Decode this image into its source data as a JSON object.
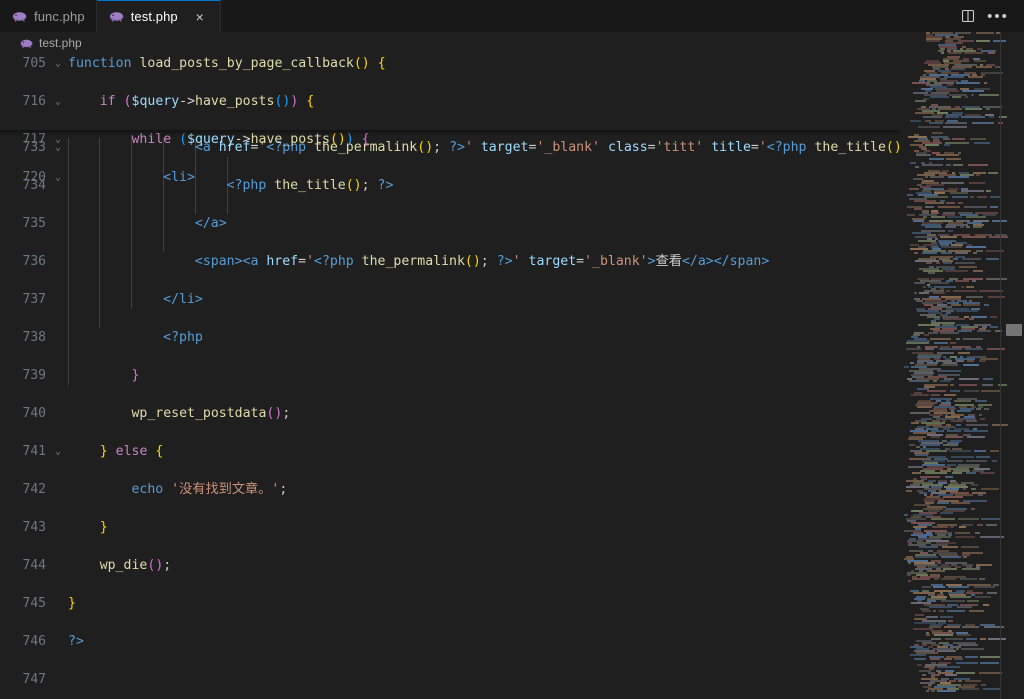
{
  "window": {
    "background": "#1f1f1f",
    "accent": "#0078d4"
  },
  "tabs": [
    {
      "label": "func.php",
      "icon": "php-elephant-icon",
      "active": false,
      "closable": false
    },
    {
      "label": "test.php",
      "icon": "php-elephant-icon",
      "active": true,
      "closable": true,
      "close_glyph": "×"
    }
  ],
  "tab_actions": {
    "split_editor_label": "Split Editor Right",
    "more_actions_label": "•••",
    "more_actions_name": "more-actions-icon"
  },
  "breadcrumb": {
    "icon": "php-elephant-icon",
    "label": "test.php"
  },
  "editor": {
    "language": "php",
    "sticky_lines": [
      {
        "num": "705",
        "fold": "⌄",
        "indent": 1,
        "tokens": [
          {
            "t": "function ",
            "c": "kb"
          },
          {
            "t": "load_posts_by_page_callback",
            "c": "fn"
          },
          {
            "t": "(",
            "c": "par"
          },
          {
            "t": ")",
            "c": "par"
          },
          {
            "t": " ",
            "c": "pun"
          },
          {
            "t": "{",
            "c": "brk"
          }
        ]
      },
      {
        "num": "716",
        "fold": "⌄",
        "indent": 2,
        "tokens": [
          {
            "t": "if ",
            "c": "k"
          },
          {
            "t": "(",
            "c": "pap"
          },
          {
            "t": "$query",
            "c": "var"
          },
          {
            "t": "->",
            "c": "op"
          },
          {
            "t": "have_posts",
            "c": "fn"
          },
          {
            "t": "(",
            "c": "pab"
          },
          {
            "t": ")",
            "c": "pab"
          },
          {
            "t": ")",
            "c": "pap"
          },
          {
            "t": " ",
            "c": "pun"
          },
          {
            "t": "{",
            "c": "par"
          }
        ]
      },
      {
        "num": "717",
        "fold": "⌄",
        "indent": 3,
        "tokens": [
          {
            "t": "while ",
            "c": "k"
          },
          {
            "t": "(",
            "c": "pab"
          },
          {
            "t": "$query",
            "c": "var"
          },
          {
            "t": "->",
            "c": "op"
          },
          {
            "t": "have_posts",
            "c": "fn"
          },
          {
            "t": "(",
            "c": "par"
          },
          {
            "t": ")",
            "c": "par"
          },
          {
            "t": ")",
            "c": "pab"
          },
          {
            "t": " ",
            "c": "pun"
          },
          {
            "t": "{",
            "c": "pap"
          }
        ]
      },
      {
        "num": "720",
        "fold": "⌄",
        "indent": 4,
        "tokens": [
          {
            "t": "<li>",
            "c": "tag"
          }
        ]
      }
    ],
    "lines": [
      {
        "num": "733",
        "fold": "⌄",
        "indent": 5,
        "clipped": true,
        "tokens": [
          {
            "t": "<a ",
            "c": "tag"
          },
          {
            "t": "href",
            "c": "atr"
          },
          {
            "t": "=",
            "c": "pun"
          },
          {
            "t": "'",
            "c": "str"
          },
          {
            "t": "<?php",
            "c": "php"
          },
          {
            "t": " ",
            "c": "pun"
          },
          {
            "t": "the_permalink",
            "c": "fn"
          },
          {
            "t": "(",
            "c": "par"
          },
          {
            "t": ")",
            "c": "par"
          },
          {
            "t": ";",
            "c": "pun"
          },
          {
            "t": " ",
            "c": "pun"
          },
          {
            "t": "?>",
            "c": "php"
          },
          {
            "t": "'",
            "c": "str"
          },
          {
            "t": " ",
            "c": "pun"
          },
          {
            "t": "target",
            "c": "atr"
          },
          {
            "t": "=",
            "c": "pun"
          },
          {
            "t": "'_blank'",
            "c": "str"
          },
          {
            "t": " ",
            "c": "pun"
          },
          {
            "t": "class",
            "c": "atr"
          },
          {
            "t": "=",
            "c": "pun"
          },
          {
            "t": "'titt'",
            "c": "str"
          },
          {
            "t": " ",
            "c": "pun"
          },
          {
            "t": "title",
            "c": "atr"
          },
          {
            "t": "=",
            "c": "pun"
          },
          {
            "t": "'",
            "c": "str"
          },
          {
            "t": "<?php",
            "c": "php"
          },
          {
            "t": " ",
            "c": "pun"
          },
          {
            "t": "the_title",
            "c": "fn"
          },
          {
            "t": "(",
            "c": "par"
          },
          {
            "t": ")",
            "c": "par"
          },
          {
            "t": ";",
            "c": "pun"
          },
          {
            "t": " ",
            "c": "pun"
          },
          {
            "t": "?",
            "c": "php"
          }
        ]
      },
      {
        "num": "734",
        "fold": "",
        "indent": 6,
        "tokens": [
          {
            "t": "<?php",
            "c": "php"
          },
          {
            "t": " ",
            "c": "pun"
          },
          {
            "t": "the_title",
            "c": "fn"
          },
          {
            "t": "(",
            "c": "par"
          },
          {
            "t": ")",
            "c": "par"
          },
          {
            "t": ";",
            "c": "pun"
          },
          {
            "t": " ",
            "c": "pun"
          },
          {
            "t": "?>",
            "c": "php"
          }
        ]
      },
      {
        "num": "735",
        "fold": "",
        "indent": 5,
        "tokens": [
          {
            "t": "</a>",
            "c": "tag"
          }
        ]
      },
      {
        "num": "736",
        "fold": "",
        "indent": 5,
        "tokens": [
          {
            "t": "<span>",
            "c": "tag"
          },
          {
            "t": "<a ",
            "c": "tag"
          },
          {
            "t": "href",
            "c": "atr"
          },
          {
            "t": "=",
            "c": "pun"
          },
          {
            "t": "'",
            "c": "str"
          },
          {
            "t": "<?php",
            "c": "php"
          },
          {
            "t": " ",
            "c": "pun"
          },
          {
            "t": "the_permalink",
            "c": "fn"
          },
          {
            "t": "(",
            "c": "par"
          },
          {
            "t": ")",
            "c": "par"
          },
          {
            "t": ";",
            "c": "pun"
          },
          {
            "t": " ",
            "c": "pun"
          },
          {
            "t": "?>",
            "c": "php"
          },
          {
            "t": "'",
            "c": "str"
          },
          {
            "t": " ",
            "c": "pun"
          },
          {
            "t": "target",
            "c": "atr"
          },
          {
            "t": "=",
            "c": "pun"
          },
          {
            "t": "'_blank'",
            "c": "str"
          },
          {
            "t": ">",
            "c": "tag"
          },
          {
            "t": "查看",
            "c": "pun"
          },
          {
            "t": "</a>",
            "c": "tag"
          },
          {
            "t": "</span>",
            "c": "tag"
          }
        ]
      },
      {
        "num": "737",
        "fold": "",
        "indent": 4,
        "tokens": [
          {
            "t": "</li>",
            "c": "tag"
          }
        ]
      },
      {
        "num": "738",
        "fold": "",
        "indent": 4,
        "tokens": [
          {
            "t": "<?php",
            "c": "php"
          }
        ]
      },
      {
        "num": "739",
        "fold": "",
        "indent": 3,
        "tokens": [
          {
            "t": "}",
            "c": "pap"
          }
        ]
      },
      {
        "num": "740",
        "fold": "",
        "indent": 3,
        "tokens": [
          {
            "t": "wp_reset_postdata",
            "c": "fn"
          },
          {
            "t": "(",
            "c": "pap"
          },
          {
            "t": ")",
            "c": "pap"
          },
          {
            "t": ";",
            "c": "pun"
          }
        ]
      },
      {
        "num": "741",
        "fold": "⌄",
        "indent": 2,
        "tokens": [
          {
            "t": "}",
            "c": "par"
          },
          {
            "t": " ",
            "c": "pun"
          },
          {
            "t": "else ",
            "c": "k"
          },
          {
            "t": "{",
            "c": "par"
          }
        ]
      },
      {
        "num": "742",
        "fold": "",
        "indent": 3,
        "tokens": [
          {
            "t": "echo ",
            "c": "kb"
          },
          {
            "t": "'没有找到文章。'",
            "c": "str"
          },
          {
            "t": ";",
            "c": "pun"
          }
        ]
      },
      {
        "num": "743",
        "fold": "",
        "indent": 2,
        "tokens": [
          {
            "t": "}",
            "c": "par"
          }
        ]
      },
      {
        "num": "744",
        "fold": "",
        "indent": 2,
        "tokens": [
          {
            "t": "wp_die",
            "c": "fn"
          },
          {
            "t": "(",
            "c": "pap"
          },
          {
            "t": ")",
            "c": "pap"
          },
          {
            "t": ";",
            "c": "pun"
          }
        ]
      },
      {
        "num": "745",
        "fold": "",
        "indent": 1,
        "tokens": [
          {
            "t": "}",
            "c": "par"
          }
        ]
      },
      {
        "num": "746",
        "fold": "",
        "indent": 1,
        "tokens": [
          {
            "t": "?>",
            "c": "php"
          }
        ]
      },
      {
        "num": "747",
        "fold": "",
        "indent": 1,
        "tokens": []
      }
    ]
  },
  "minimap": {
    "name": "minimap",
    "viewport_visible": true
  },
  "scrollbar": {
    "marker_name": "scroll-position-marker"
  }
}
